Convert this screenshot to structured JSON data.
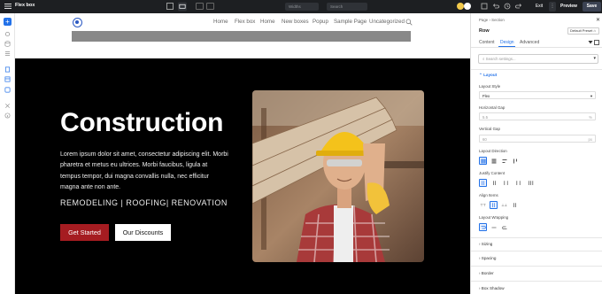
{
  "topbar": {
    "title": "Flex box",
    "title_chevron": "⌄",
    "widths_label": "Widths",
    "search_placeholder": "Search",
    "exit": "Exit",
    "more": "⋮",
    "preview": "Preview",
    "save": "Save",
    "dot_colors": [
      "#f2c94c",
      "#ffffff"
    ]
  },
  "rail": {
    "add": "+"
  },
  "site": {
    "nav": [
      "Home",
      "Flex box",
      "Home",
      "New boxes",
      "Popup",
      "Sample Page",
      "Uncategorized"
    ],
    "hero": {
      "title": "Construction",
      "body": "Lorem ipsum dolor sit amet, consectetur adipiscing elit. Morbi pharetra et metus eu ultrices. Morbi faucibus, ligula at tempus tempor, dui magna convallis nulla, nec efficitur magna ante non ante.",
      "tagline": "REMODELING | ROOFING| RENOVATION",
      "btn_primary": "Get Started",
      "btn_secondary": "Our Discounts"
    }
  },
  "panel": {
    "breadcrumb": "Page › Section",
    "close": "✕",
    "element_title": "Row",
    "preset": "Default Preset ⌂",
    "tabs": [
      "Content",
      "Design",
      "Advanced"
    ],
    "active_tab": "Design",
    "search_placeholder": "⌕ Search settings...",
    "search_caret": "▾",
    "layout_section": "⌃  Layout",
    "layout_style_label": "Layout Style",
    "layout_style_value": "Flex",
    "hgap_label": "Horizontal Gap",
    "hgap_value": "5.5",
    "hgap_unit": "%",
    "vgap_label": "Vertical Gap",
    "vgap_value": "60",
    "vgap_unit": "px",
    "direction_label": "Layout Direction",
    "justify_label": "Justify Content",
    "justify_options": [
      "┃┃",
      "┃┃",
      "┃ ┃",
      "┃ ┃",
      "┃┃┃"
    ],
    "align_label": "Align Items",
    "align_options": [
      "⊤⊤",
      "┃┃",
      "⊥⊥",
      "┃┃"
    ],
    "wrap_label": "Layout Wrapping",
    "collapsed_sections": [
      "›  Sizing",
      "›  Spacing",
      "›  Border",
      "›  Box Shadow"
    ],
    "accent": "#2271e8"
  }
}
